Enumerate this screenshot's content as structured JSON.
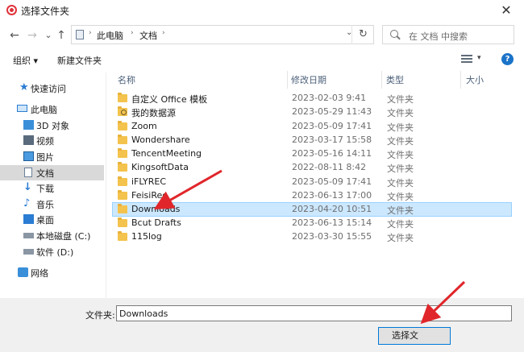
{
  "window": {
    "title": "选择文件夹",
    "close_glyph": "✕"
  },
  "address": {
    "back_glyph": "←",
    "forward_glyph": "→",
    "recent_glyph": "⌄",
    "up_glyph": "↑",
    "segments": [
      "此电脑",
      "文档"
    ],
    "chevron": "›",
    "dropdown_glyph": "⌄",
    "refresh_glyph": "↻",
    "search_placeholder": "在 文档 中搜索"
  },
  "toolbar": {
    "organize_label": "组织 ▾",
    "new_folder_label": "新建文件夹",
    "view_drop_glyph": "▾",
    "help_glyph": "?"
  },
  "sidebar": {
    "items": [
      {
        "label": "快速访问",
        "icon": "star-icon"
      },
      {
        "label": "此电脑",
        "icon": "monitor-icon"
      },
      {
        "label": "3D 对象",
        "icon": "cube-icon"
      },
      {
        "label": "视频",
        "icon": "film-icon"
      },
      {
        "label": "图片",
        "icon": "picture-icon"
      },
      {
        "label": "文档",
        "icon": "document-icon",
        "selected": true
      },
      {
        "label": "下载",
        "icon": "download-icon"
      },
      {
        "label": "音乐",
        "icon": "music-icon"
      },
      {
        "label": "桌面",
        "icon": "desktop-icon"
      },
      {
        "label": "本地磁盘 (C:)",
        "icon": "drive-icon"
      },
      {
        "label": "软件 (D:)",
        "icon": "drive-icon"
      },
      {
        "label": "网络",
        "icon": "network-icon"
      }
    ]
  },
  "columns": {
    "name": "名称",
    "modified": "修改日期",
    "type": "类型",
    "size": "大小"
  },
  "files": [
    {
      "name": "自定义 Office 模板",
      "modified": "2023-02-03 9:41",
      "type": "文件夹"
    },
    {
      "name": "我的数据源",
      "modified": "2023-05-29 11:43",
      "type": "文件夹",
      "special": true
    },
    {
      "name": "Zoom",
      "modified": "2023-05-09 17:41",
      "type": "文件夹"
    },
    {
      "name": "Wondershare",
      "modified": "2023-03-17 15:58",
      "type": "文件夹"
    },
    {
      "name": "TencentMeeting",
      "modified": "2023-05-16 14:11",
      "type": "文件夹"
    },
    {
      "name": "KingsoftData",
      "modified": "2022-08-11 8:42",
      "type": "文件夹"
    },
    {
      "name": "iFLYREC",
      "modified": "2023-05-09 17:41",
      "type": "文件夹"
    },
    {
      "name": "FeisiRec",
      "modified": "2023-06-13 17:00",
      "type": "文件夹"
    },
    {
      "name": "Downloads",
      "modified": "2023-04-20 10:51",
      "type": "文件夹",
      "selected": true
    },
    {
      "name": "Bcut Drafts",
      "modified": "2023-06-13 15:14",
      "type": "文件夹"
    },
    {
      "name": "115log",
      "modified": "2023-03-30 15:55",
      "type": "文件夹"
    }
  ],
  "footer": {
    "folder_label": "文件夹:",
    "folder_value": "Downloads",
    "select_button": "选择文",
    "cancel_button": ""
  },
  "colors": {
    "accent": "#0078d7",
    "selection": "#cce8ff",
    "annotation_arrow": "#e0262b"
  }
}
